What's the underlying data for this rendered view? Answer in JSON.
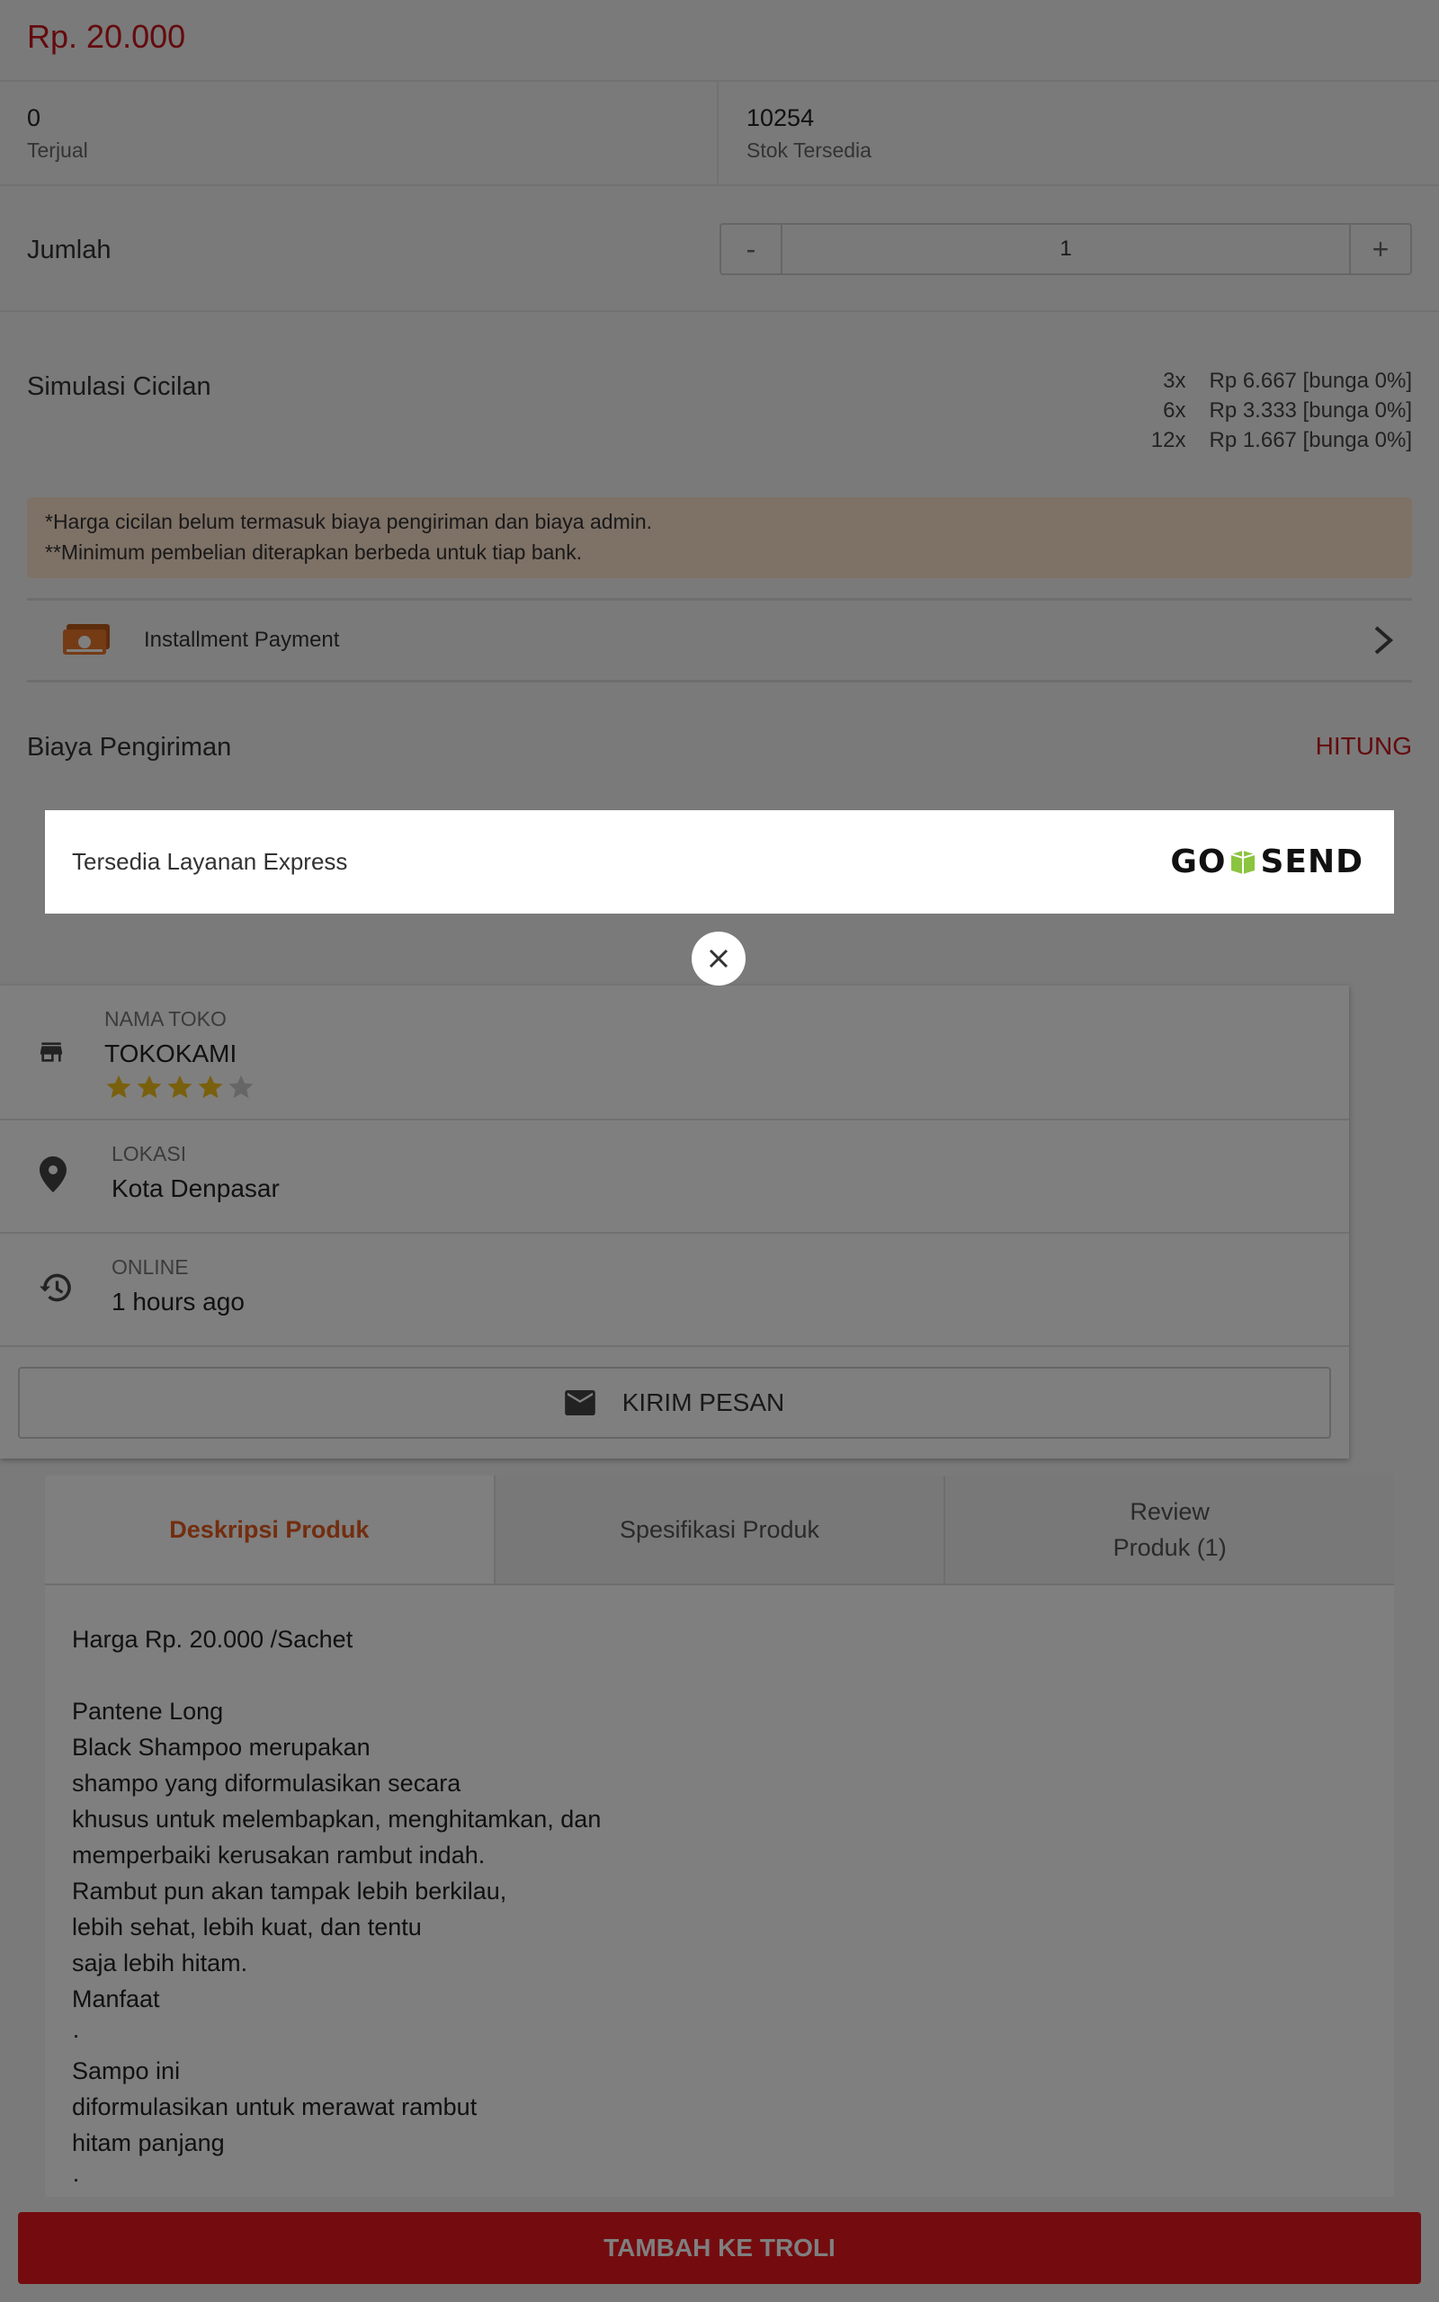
{
  "product": {
    "price": "Rp. 20.000",
    "sold_value": "0",
    "sold_label": "Terjual",
    "stock_value": "10254",
    "stock_label": "Stok Tersedia"
  },
  "quantity": {
    "label": "Jumlah",
    "minus": "-",
    "value": "1",
    "plus": "+"
  },
  "installment": {
    "label": "Simulasi Cicilan",
    "rows": [
      {
        "n": "3x",
        "amount": "Rp 6.667 [bunga 0%]"
      },
      {
        "n": "6x",
        "amount": "Rp 3.333 [bunga 0%]"
      },
      {
        "n": "12x",
        "amount": "Rp 1.667 [bunga 0%]"
      }
    ],
    "note_1": "*Harga cicilan belum termasuk biaya pengiriman dan biaya admin.",
    "note_2": "**Minimum pembelian diterapkan berbeda untuk tiap bank.",
    "payment_label": "Installment Payment"
  },
  "shipping": {
    "label": "Biaya Pengiriman",
    "action": "HITUNG"
  },
  "express_popup": {
    "text": "Tersedia Layanan Express",
    "logo_go": "GO",
    "logo_send": "SEND"
  },
  "store": {
    "name_caption": "NAMA TOKO",
    "name": "TOKOKAMI",
    "rating": 4,
    "location_caption": "LOKASI",
    "location": "Kota Denpasar",
    "online_caption": "ONLINE",
    "online": "1 hours ago",
    "message_button": "KIRIM PESAN"
  },
  "tabs": {
    "description": "Deskripsi Produk",
    "specification": "Spesifikasi Produk",
    "review": "Review\nProduk (1)"
  },
  "description_text": "Harga Rp. 20.000 /Sachet\n\nPantene Long\nBlack Shampoo merupakan\nshampo yang diformulasikan secara\nkhusus untuk melembapkan, menghitamkan, dan\nmemperbaiki kerusakan rambut indah.\nRambut pun akan tampak lebih berkilau,\nlebih sehat, lebih kuat, dan tentu\nsaja lebih hitam.\nManfaat\n·\nSampo ini\ndiformulasikan untuk merawat rambut\nhitam panjang\n·",
  "cart_button": "TAMBAH KE TROLI",
  "colors": {
    "brand_red": "#c8171d",
    "button_red": "#e8181f",
    "tab_active": "#e65a1e",
    "star": "#f2c01a",
    "gosend_green": "#8bc43f"
  }
}
